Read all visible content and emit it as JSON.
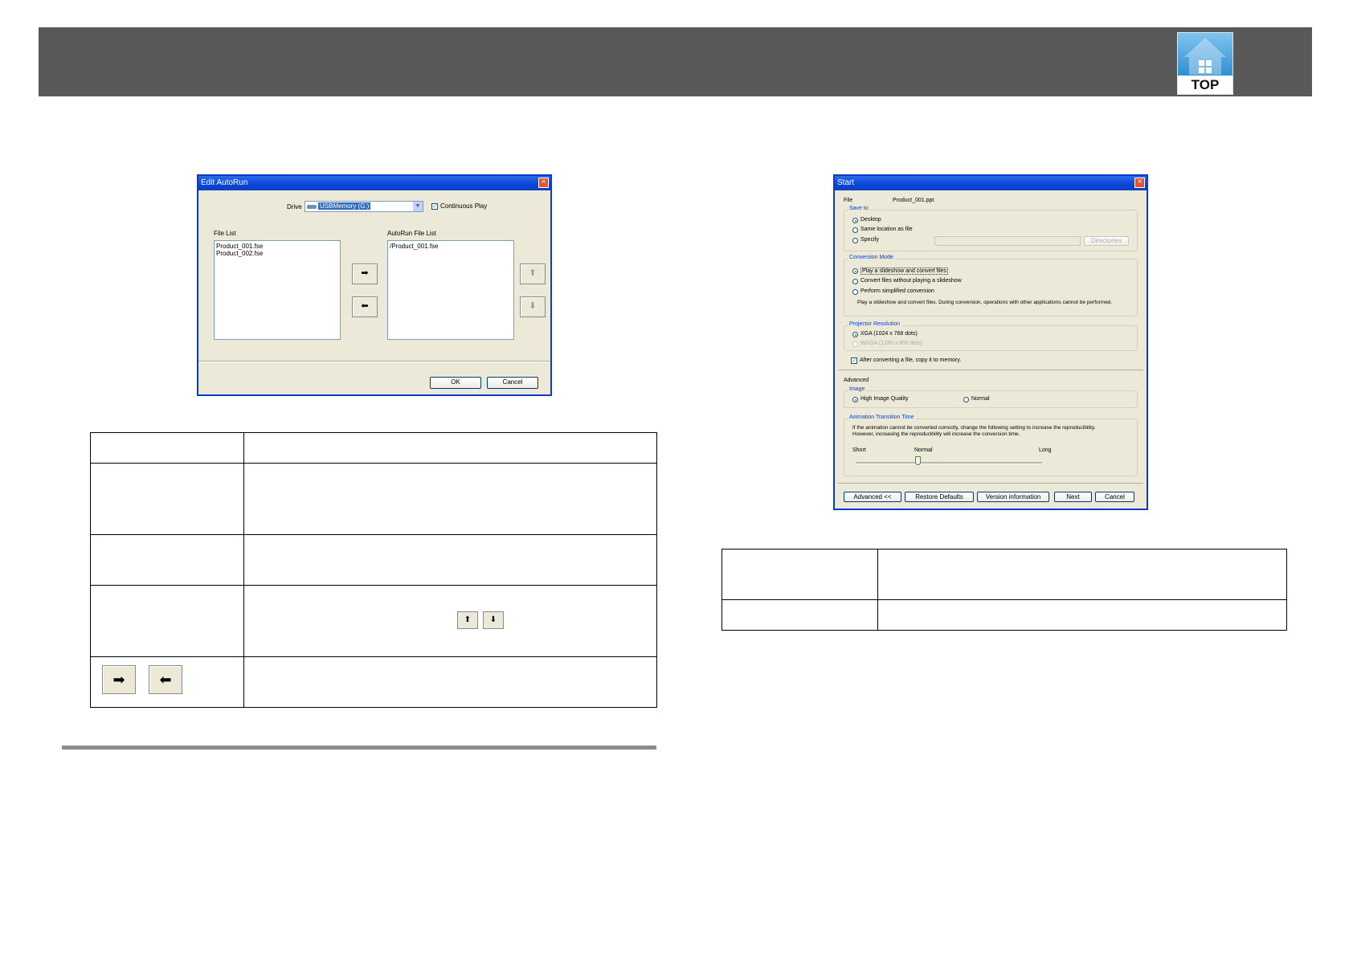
{
  "header": {
    "logo_text": "TOP"
  },
  "edit_autorun": {
    "title": "Edit AutoRun",
    "drive_label": "Drive",
    "drive_value": "USBMemory (G:)",
    "continuous_play": "Continuous Play",
    "file_list_label": "File List",
    "file_list": [
      "Product_001.fse",
      "Product_002.fse"
    ],
    "autorun_list_label": "AutoRun File List",
    "autorun_list": [
      "/Product_001.fse"
    ],
    "ok": "OK",
    "cancel": "Cancel"
  },
  "start_dialog": {
    "title": "Start",
    "file_label": "File",
    "file_value": "Product_001.ppt",
    "save_to": {
      "label": "Save to",
      "options": [
        "Desktop",
        "Same location as file",
        "Specify"
      ],
      "selected": "Desktop",
      "directories": "Directories"
    },
    "conversion_mode": {
      "label": "Conversion Mode",
      "options": [
        "Play a slideshow and convert files",
        "Convert files without playing a slideshow",
        "Perform simplified conversion"
      ],
      "selected": "Play a slideshow and convert files",
      "description": "Play a slideshow and convert files. During conversion, operations with other applications cannot be performed."
    },
    "projector_resolution": {
      "label": "Projector Resolution",
      "options": [
        "XGA (1024 x 768 dots)",
        "WXGA (1280 x 800 dots)"
      ],
      "selected": "XGA (1024 x 768 dots)"
    },
    "copy_to_memory": "After converting a file, copy it to memory.",
    "advanced_label": "Advanced",
    "image": {
      "label": "Image",
      "options": [
        "High Image Quality",
        "Normal"
      ],
      "selected": "High Image Quality"
    },
    "animation": {
      "label": "Animation Transition Time",
      "description_line1": "If the animation cannot be converted correctly, change the following setting to increase the reproducibility.",
      "description_line2": "However, increasing the reproducibility will increase the conversion time.",
      "scale": [
        "Short",
        "Normal",
        "Long"
      ],
      "slider_value": 0.33
    },
    "buttons": {
      "advanced": "Advanced <<",
      "restore": "Restore Defaults",
      "version": "Version information",
      "next": "Next",
      "cancel": "Cancel"
    }
  },
  "colors": {
    "header_bg": "#595959",
    "dialog_bg": "#ece9d8",
    "titlebar": "#0a45d8"
  }
}
